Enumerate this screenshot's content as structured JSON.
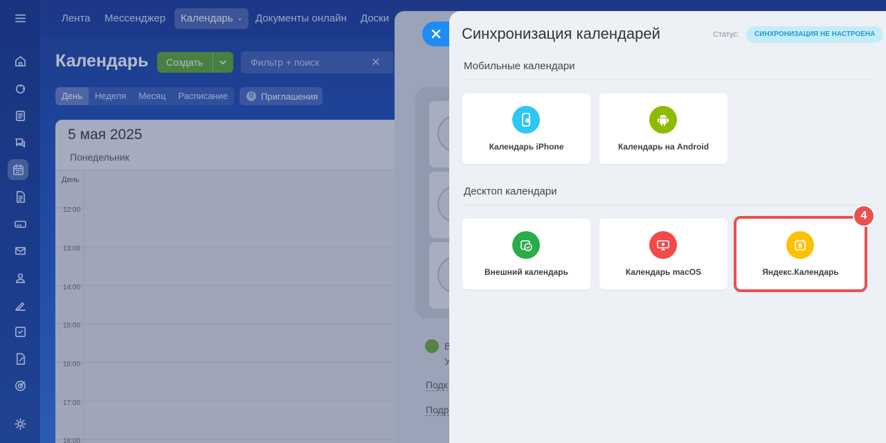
{
  "colors": {
    "accent_blue": "#1d8cf5",
    "highlight_red": "#e95150",
    "status_text": "#1e9dcf",
    "status_bg": "#c5ecfa"
  },
  "topnav": {
    "items": [
      "Лента",
      "Мессенджер",
      "Календарь",
      "Документы онлайн",
      "Доски"
    ]
  },
  "leftbar": {
    "icons": [
      "menu-icon",
      "home-icon",
      "feed-icon",
      "tasks-icon",
      "chat-icon",
      "calendar-icon",
      "document-icon",
      "drive-icon",
      "mail-icon",
      "contacts-icon",
      "sign-icon",
      "checklist-icon",
      "forms-icon",
      "target-icon",
      "settings-icon"
    ]
  },
  "calendar": {
    "title": "Календарь",
    "create_label": "Создать",
    "filter_placeholder": "Фильтр + поиск",
    "view_tabs": [
      "День",
      "Неделя",
      "Месяц",
      "Расписание"
    ],
    "invites_count": "0",
    "invites_label": "Приглашения",
    "date": "5 мая 2025",
    "weekday": "Понедельник",
    "day_label": "День",
    "hours": [
      "12:00",
      "13:00",
      "14:00",
      "15:00",
      "16:00",
      "17:00",
      "18:00"
    ]
  },
  "mid_panel": {
    "text_lines": [
      "В",
      "У",
      "Подк",
      "Подр"
    ]
  },
  "sync": {
    "title": "Синхронизация календарей",
    "status_label": "Статус:",
    "status_value": "Синхронизация не настроена",
    "mobile_section": "Мобильные календари",
    "desktop_section": "Десктоп календари",
    "mobile_tiles": [
      {
        "label": "Календарь iPhone",
        "icon": "iphone-icon",
        "color": "#2fc6f6"
      },
      {
        "label": "Календарь на Android",
        "icon": "android-icon",
        "color": "#8dbb00"
      }
    ],
    "desktop_tiles": [
      {
        "label": "Внешний календарь",
        "icon": "external-sync-icon",
        "color": "#29ad49"
      },
      {
        "label": "Календарь macOS",
        "icon": "macos-icon",
        "color": "#f2494b"
      },
      {
        "label": "Яндекс.Календарь",
        "icon": "yandex-calendar-icon",
        "color": "#fdc100"
      }
    ],
    "step_badge": "4"
  }
}
